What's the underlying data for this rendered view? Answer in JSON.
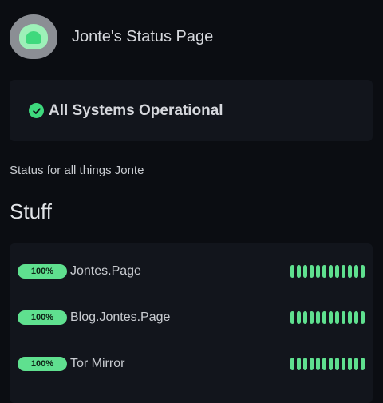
{
  "header": {
    "title": "Jonte's Status Page"
  },
  "status": {
    "text": "All Systems Operational",
    "color": "#3ed97d"
  },
  "description": "Status for all things Jonte",
  "section": {
    "title": "Stuff"
  },
  "services": [
    {
      "badge": "100%",
      "name": "Jontes.Page",
      "uptime": 1.0,
      "bars": 12
    },
    {
      "badge": "100%",
      "name": "Blog.Jontes.Page",
      "uptime": 1.0,
      "bars": 12
    },
    {
      "badge": "100%",
      "name": "Tor Mirror",
      "uptime": 1.0,
      "bars": 12
    }
  ],
  "colors": {
    "background": "#0b0d12",
    "card": "#12151c",
    "accent": "#5fe08f"
  }
}
